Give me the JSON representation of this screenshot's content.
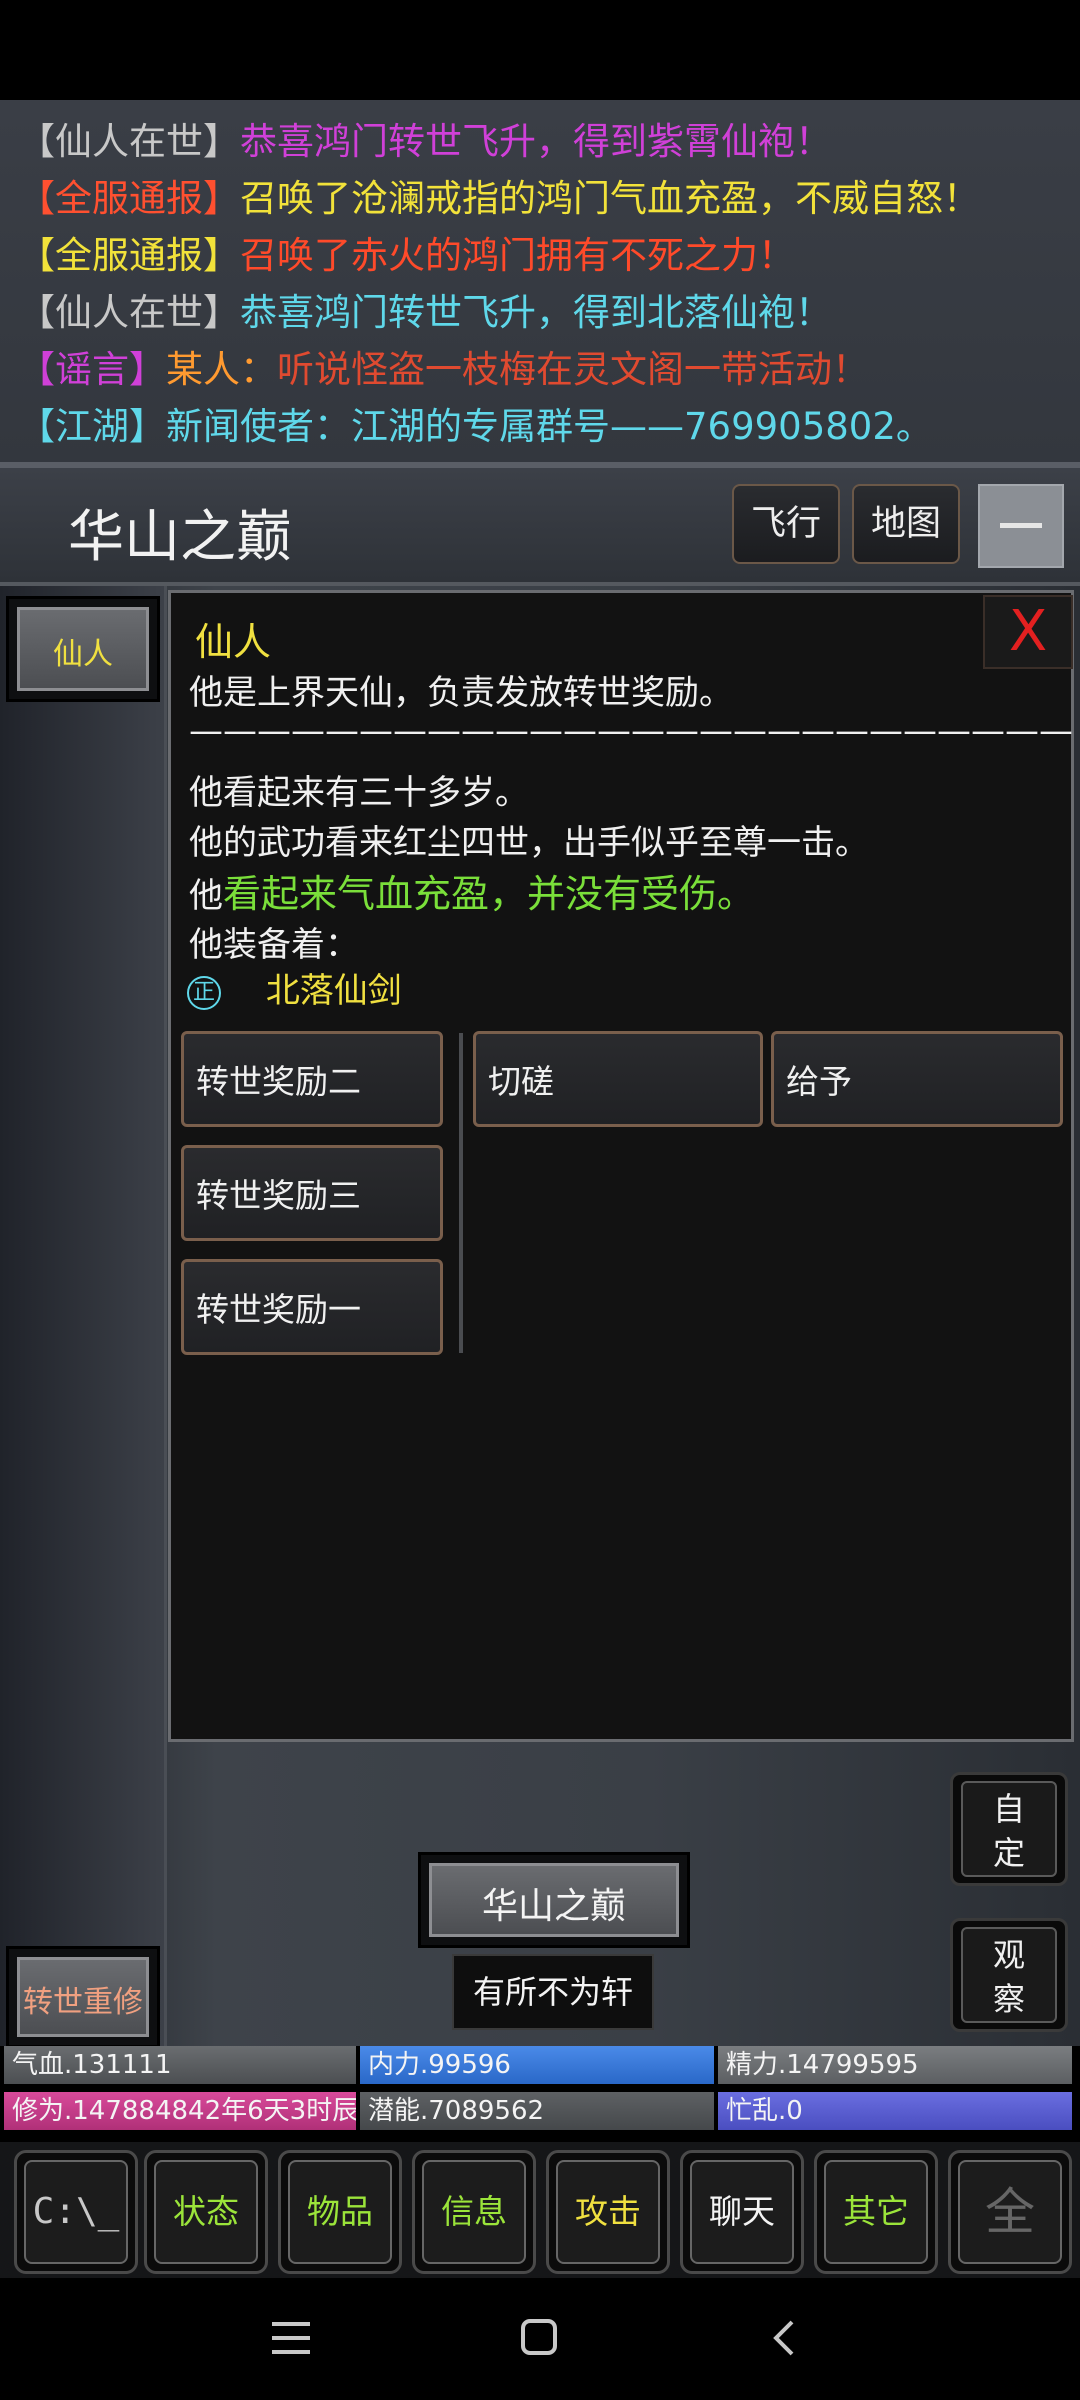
{
  "chat": [
    {
      "parts": [
        {
          "text": "【仙人在世】",
          "color": "#c8c8c8"
        },
        {
          "text": "恭喜鸿门转世飞升，得到紫霄仙袍！",
          "color": "#d040d8"
        }
      ]
    },
    {
      "parts": [
        {
          "text": "【全服通报】",
          "color": "#ff5030"
        },
        {
          "text": "召唤了沧澜戒指的鸿门气血充盈，不威自怒！",
          "color": "#f2e23a"
        }
      ]
    },
    {
      "parts": [
        {
          "text": "【全服通报】",
          "color": "#f2e23a"
        },
        {
          "text": "召唤了赤火的鸿门拥有不死之力！",
          "color": "#ff4a2a"
        }
      ]
    },
    {
      "parts": [
        {
          "text": "【仙人在世】",
          "color": "#c8c8c8"
        },
        {
          "text": "恭喜鸿门转世飞升，得到北落仙袍！",
          "color": "#5fd8ea"
        }
      ]
    },
    {
      "parts": [
        {
          "text": "【谣言】",
          "color": "#d040d8"
        },
        {
          "text": "某人：",
          "color": "#ff9a30"
        },
        {
          "text": "听说怪盗一枝梅在灵文阁一带活动！",
          "color": "#e04a30"
        }
      ]
    },
    {
      "parts": [
        {
          "text": "【江湖】",
          "color": "#5fd8ea"
        },
        {
          "text": "新闻使者：江湖的专属群号——769905802。",
          "color": "#5fd8ea"
        }
      ]
    }
  ],
  "header": {
    "location": "华山之巅",
    "fly_label": "飞行",
    "map_label": "地图"
  },
  "left": {
    "npc_label": "仙人",
    "rebirth_label": "转世重修"
  },
  "dialog": {
    "name": "仙人",
    "close_label": "X",
    "desc": "他是上界天仙，负责发放转世奖励。",
    "separator": "——————————————————————————",
    "age": "他看起来有三十多岁。",
    "skill": "他的武功看来红尘四世，出手似乎至尊一击。",
    "health_prefix": "他",
    "health": "看起来气血充盈，并没有受伤。",
    "equip_title": "他装备着：",
    "equip_badge": "正",
    "equip_item": "北落仙剑",
    "actions_left": [
      "转世奖励二",
      "转世奖励三",
      "转世奖励一"
    ],
    "actions_right": [
      "切磋",
      "给予"
    ]
  },
  "right_buttons": {
    "custom": [
      "自",
      "定"
    ],
    "observe": [
      "观",
      "察"
    ]
  },
  "bottom": {
    "location_btn": "华山之巅",
    "player_tag": "有所不为轩"
  },
  "stats": {
    "hp": "气血.131111",
    "neili": "内力.99596",
    "jingli": "精力.14799595",
    "cultivation": "修为.147884842年6天3时辰",
    "potential": "潜能.7089562",
    "busy": "忙乱.0"
  },
  "tabs": {
    "console": "C:\\_",
    "status": "状态",
    "items": "物品",
    "info": "信息",
    "attack": "攻击",
    "chat": "聊天",
    "other": "其它",
    "more": "全"
  },
  "colors": {
    "gold_text": "#f0e040",
    "green_text": "#7adf3a",
    "accent_green": "#9be43a",
    "close_red": "#e32020"
  }
}
